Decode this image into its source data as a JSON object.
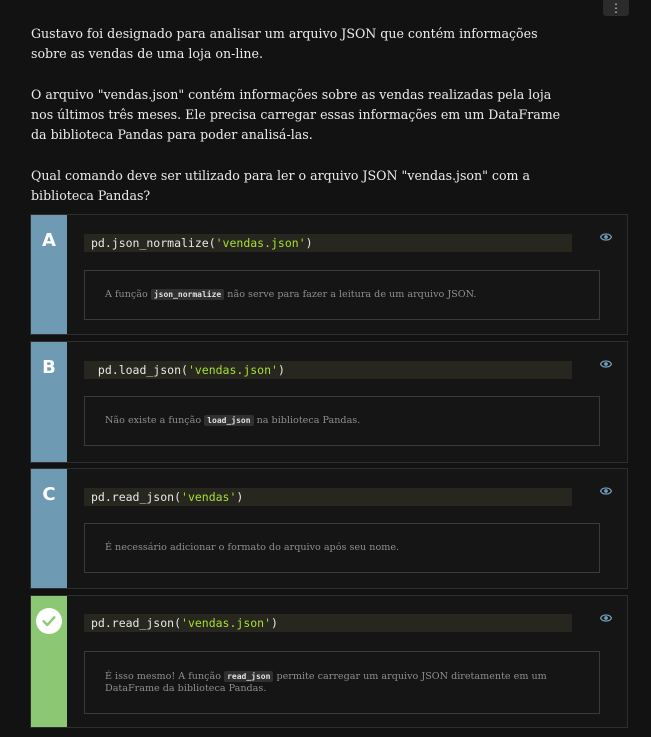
{
  "menu": {
    "icon": "kebab-menu-icon",
    "glyph": "⋮"
  },
  "question": {
    "p1": "Gustavo foi designado para analisar um arquivo JSON que contém informações sobre as vendas de uma loja on-line.",
    "p2": "O arquivo \"vendas.json\" contém informações sobre as vendas realizadas pela loja nos últimos três meses. Ele precisa carregar essas informações em um DataFrame da biblioteca Pandas para poder analisá-las.",
    "p3": "Qual comando deve ser utilizado para ler o arquivo JSON \"vendas.json\" com a biblioteca Pandas?"
  },
  "alternatives": [
    {
      "letter": "A",
      "code_prefix": "pd.json_normalize(",
      "code_string": "'vendas.json'",
      "code_suffix": ")",
      "expl_before": "A função ",
      "expl_code": "json_normalize",
      "expl_after": " não serve para fazer a leitura de um arquivo JSON."
    },
    {
      "letter": "B",
      "code_prefix": " pd.load_json(",
      "code_string": "'vendas.json'",
      "code_suffix": ")",
      "expl_before": "Não existe a função ",
      "expl_code": "load_json",
      "expl_after": " na biblioteca Pandas."
    },
    {
      "letter": "C",
      "code_prefix": "pd.read_json(",
      "code_string": "'vendas'",
      "code_suffix": ")",
      "expl_before": "É necessário adicionar o formato do arquivo após seu nome.",
      "expl_code": "",
      "expl_after": ""
    },
    {
      "letter": "",
      "status": "correct",
      "code_prefix": "pd.read_json(",
      "code_string": "'vendas.json'",
      "code_suffix": ")",
      "expl_before": "É isso mesmo! A função ",
      "expl_code": "read_json",
      "expl_after": " permite carregar um arquivo JSON diretamente em um DataFrame da biblioteca Pandas."
    }
  ],
  "colors": {
    "letter_bg": "#6f9ab3",
    "correct_bg": "#8cc873",
    "string_color": "#a6e22e",
    "eye_color": "#6f9ab3"
  },
  "icons": {
    "reveal": "eye-icon",
    "correct": "checkmark-icon"
  }
}
